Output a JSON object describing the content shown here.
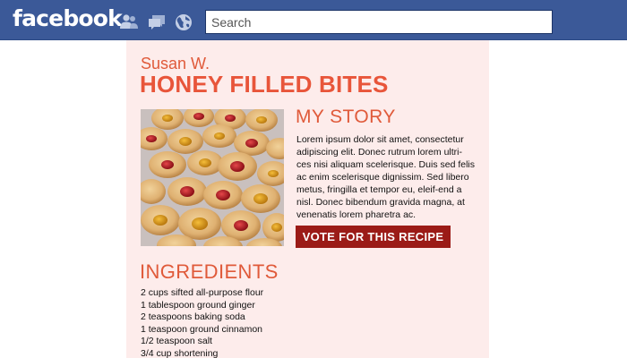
{
  "header": {
    "logo": "facebook",
    "icons": [
      "friends-icon",
      "messages-icon",
      "globe-icon"
    ],
    "search": {
      "placeholder": "Search",
      "value": ""
    }
  },
  "recipe": {
    "author": "Susan W.",
    "title": "HONEY FILLED BITES",
    "story_heading": "MY STORY",
    "story_text": "Lorem ipsum dolor sit amet, consectetur adipiscing elit. Donec rutrum lorem ultri-ces nisi aliquam scelerisque. Duis sed felis ac enim scelerisque dignissim. Sed libero metus, fringilla et tempor eu, eleif-end a nisl. Donec bibendum gravida magna, at venenatis lorem pharetra ac.",
    "vote_label": "VOTE FOR THIS RECIPE",
    "ingredients_heading": "INGREDIENTS",
    "ingredients": [
      "2 cups sifted all-purpose flour",
      "1 tablespoon ground ginger",
      "2 teaspoons baking soda",
      "1 teaspoon ground cinnamon",
      "1/2 teaspoon salt",
      "3/4 cup shortening"
    ]
  },
  "colors": {
    "facebook_blue": "#3b5998",
    "panel_background": "#fdeceb",
    "accent": "#e05a3a",
    "vote_button": "#9b1b17"
  }
}
